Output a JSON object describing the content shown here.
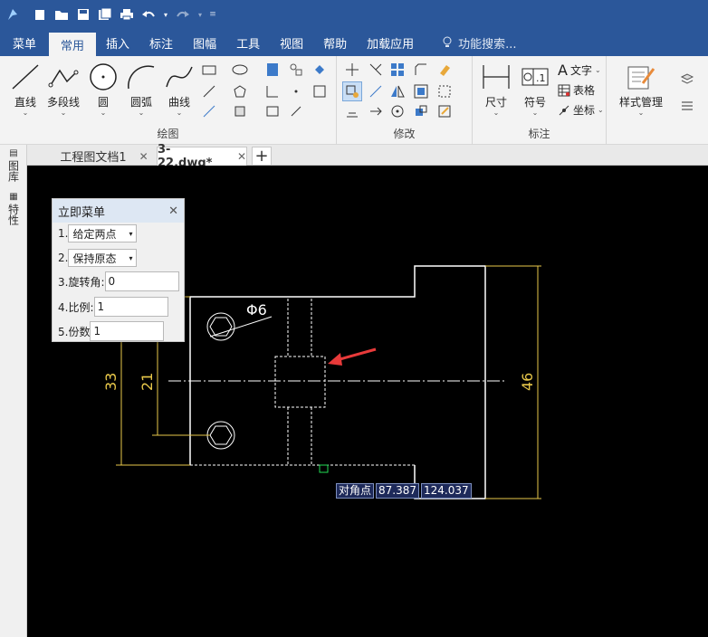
{
  "quick_access": [
    "app-logo-icon",
    "new-file-icon",
    "open-file-icon",
    "save-icon",
    "save-all-icon",
    "print-icon",
    "undo-icon",
    "redo-icon",
    "customize-icon"
  ],
  "menu": {
    "tabs": [
      "菜单",
      "常用",
      "插入",
      "标注",
      "图幅",
      "工具",
      "视图",
      "帮助",
      "加载应用"
    ],
    "active": "常用",
    "search_label": "功能搜索..."
  },
  "ribbon": {
    "draw": {
      "label": "绘图",
      "line": "直线",
      "polyline": "多段线",
      "circle": "圆",
      "arc": "圆弧",
      "curve": "曲线"
    },
    "modify": {
      "label": "修改"
    },
    "annotate": {
      "label": "标注",
      "dimension": "尺寸",
      "symbol": "符号",
      "text": "文字",
      "table": "表格",
      "coordinate": "坐标"
    },
    "style": {
      "label": "样式管理"
    }
  },
  "doc_tabs": [
    "工程图文档1",
    "3-22.dwg*"
  ],
  "active_doc": "3-22.dwg*",
  "side_panel": [
    "图库",
    "特性"
  ],
  "immediate_menu": {
    "title": "立即菜单",
    "row1_label": "1.",
    "row1_value": "给定两点",
    "row2_label": "2.",
    "row2_value": "保持原态",
    "row3_label": "3.旋转角:",
    "row3_value": "0",
    "row4_label": "4.比例:",
    "row4_value": "1",
    "row5_label": "5.份数",
    "row5_value": "1"
  },
  "drawing": {
    "dim_33": "33",
    "dim_21": "21",
    "dim_46": "46",
    "dim_phi6": "Φ6",
    "line_color": "#ffffff",
    "dim_color": "#e8c84a",
    "arrow_color": "#e83a3a",
    "cursor_color": "#22dd55"
  },
  "coord_readout": {
    "label": "对角点",
    "x": "87.387",
    "y": "124.037"
  }
}
